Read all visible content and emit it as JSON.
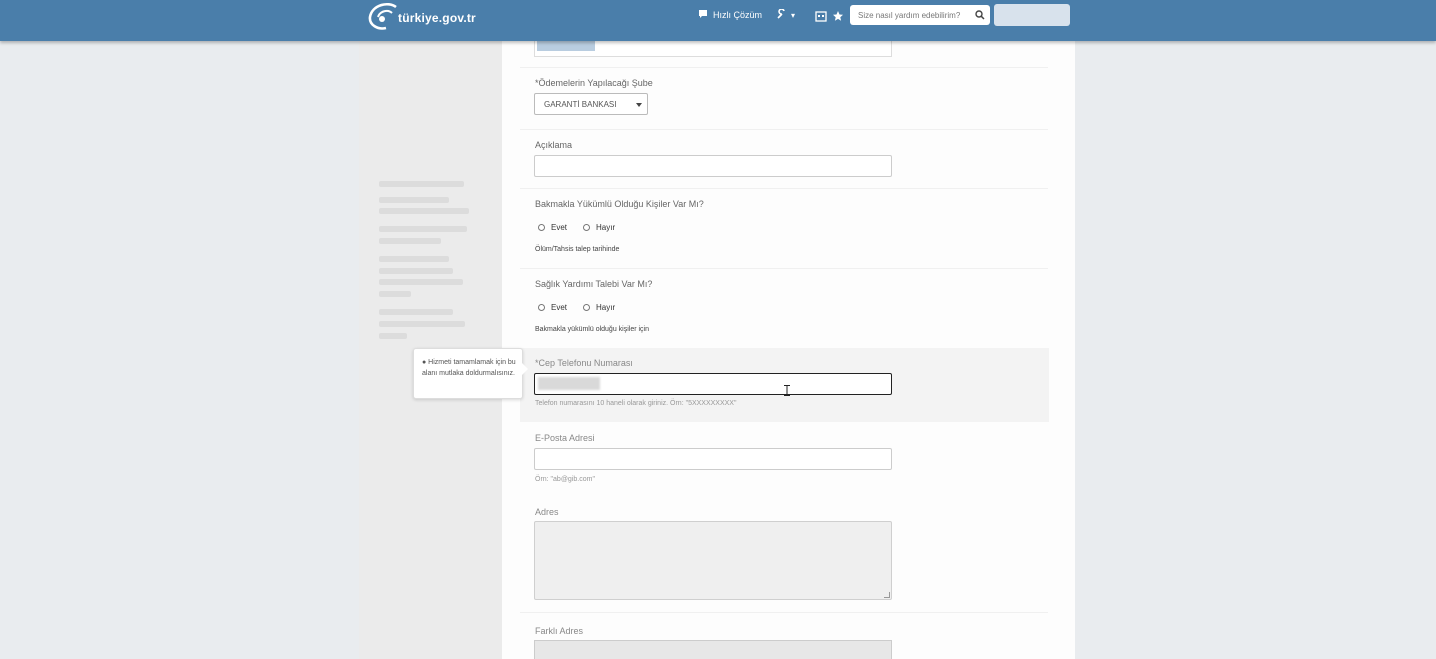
{
  "header": {
    "logo_text": "türkiye.gov.tr",
    "quick_solution": "Hızlı Çözüm",
    "search_placeholder": "Size nasıl yardım edebilirim?",
    "brand_color": "#4a7eaa"
  },
  "form": {
    "payment_branch_label": "*Ödemelerin Yapılacağı Şube",
    "payment_branch_value": "GARANTİ BANKASI",
    "description_label": "Açıklama",
    "dependents_question": "Bakmakla Yükümlü Olduğu Kişiler Var Mı?",
    "dependents_yes": "Evet",
    "dependents_no": "Hayır",
    "dependents_hint": "Ölüm/Tahsis talep tarihinde",
    "health_question": "Sağlık Yardımı Talebi Var Mı?",
    "health_yes": "Evet",
    "health_no": "Hayır",
    "health_hint": "Bakmakla yükümlü olduğu kişiler için",
    "mobile_label": "*Cep Telefonu Numarası",
    "mobile_hint": "Telefon numarasını 10 haneli olarak giriniz. Örn: \"5XXXXXXXXX\"",
    "email_label": "E-Posta Adresi",
    "email_hint": "Örn: \"ab@gib.com\"",
    "address_label": "Adres",
    "legal_address_label": "Farklı Adres"
  },
  "tooltip": {
    "text": "● Hizmeti tamamlamak için bu alanı mutlaka doldurmalısınız."
  }
}
